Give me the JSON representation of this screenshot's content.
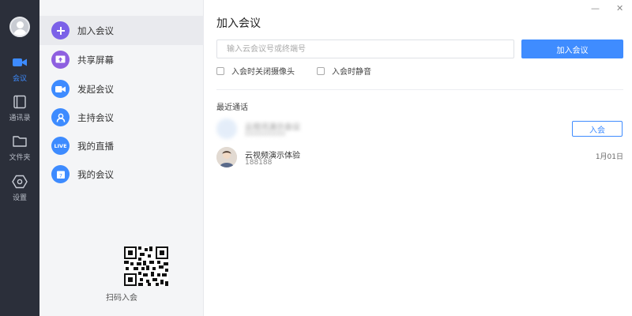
{
  "rail": {
    "items": [
      {
        "label": "会议",
        "icon": "video-camera-icon",
        "active": true
      },
      {
        "label": "通讯录",
        "icon": "contacts-book-icon",
        "active": false
      },
      {
        "label": "文件夹",
        "icon": "folder-icon",
        "active": false
      },
      {
        "label": "设置",
        "icon": "settings-hexagon-icon",
        "active": false
      }
    ]
  },
  "menu": {
    "items": [
      {
        "label": "加入会议",
        "icon": "plus-icon",
        "color": "#7b61e8"
      },
      {
        "label": "共享屏幕",
        "icon": "share-screen-icon",
        "color": "#8e5fe0"
      },
      {
        "label": "发起会议",
        "icon": "video-icon",
        "color": "#3d8bff"
      },
      {
        "label": "主持会议",
        "icon": "host-icon",
        "color": "#3d8bff"
      },
      {
        "label": "我的直播",
        "icon": "live-icon",
        "color": "#3d8bff"
      },
      {
        "label": "我的会议",
        "icon": "calendar-icon",
        "color": "#3d8bff"
      }
    ],
    "qr_label": "扫码入会"
  },
  "main": {
    "title": "加入会议",
    "input_placeholder": "输入云会议号或终端号",
    "join_button": "加入会议",
    "options": [
      {
        "label": "入会时关闭摄像头",
        "checked": false
      },
      {
        "label": "入会时静音",
        "checked": false
      }
    ],
    "recent_title": "最近通话",
    "recent": [
      {
        "name": "云视讯演示会议",
        "sub": "888888888",
        "action": "入会",
        "date": "",
        "blurred": true
      },
      {
        "name": "云视频演示体验",
        "sub": "188188",
        "action": "",
        "date": "1月01日",
        "blurred": false
      }
    ],
    "window_controls": {
      "minimize": "—",
      "close": "✕"
    }
  },
  "colors": {
    "accent": "#3f8cff",
    "rail_bg": "#2b2f3a",
    "menu_bg": "#f4f5f7"
  }
}
